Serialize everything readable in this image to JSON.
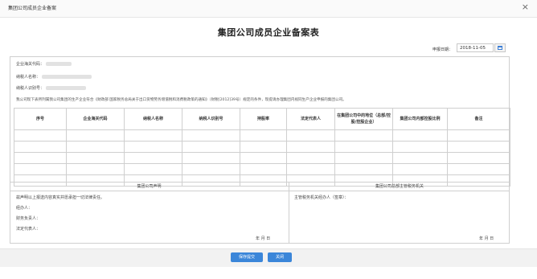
{
  "window": {
    "title": "集团公司成员企业备案"
  },
  "form": {
    "title": "集团公司成员企业备案表"
  },
  "date": {
    "label": "申报日期：",
    "value": "2018-11-05"
  },
  "info": {
    "customs_code_label": "企业海关代码：",
    "taxpayer_name_label": "纳税人名称：",
    "taxpayer_id_label": "纳税人识别号："
  },
  "statement": "我公司现下表所列属我公司集团的生产企业符合《财政部 国家税务总局关于出口货物劳务增值税和消费税政策的通知》（财税[2012]39号）规定的条件，现提请办理集团内视同生产企业申报的集团公司。",
  "table": {
    "headers": [
      "序号",
      "企业海关代码",
      "纳税人名称",
      "纳税人识别号",
      "持股率",
      "法定代表人",
      "在集团公司中的地位（总部/控股/控股企业）",
      "集团公司内部控股比例",
      "备注"
    ]
  },
  "left_section": {
    "header": "集团公司声明",
    "declaration": "兹声明以上报送内容真实并愿承担一切法律责任。",
    "agent_label": "经办人：",
    "finance_label": "财务负责人：",
    "legal_rep_label": "法定代表人：",
    "date_text": "年  月  日"
  },
  "right_section": {
    "header": "集团公司总部主管税务机关",
    "opinion_label": "主管税务机关经办人（签章）：",
    "date_text": "年  月  日"
  },
  "buttons": {
    "save": "保存提交",
    "close": "关闭"
  }
}
